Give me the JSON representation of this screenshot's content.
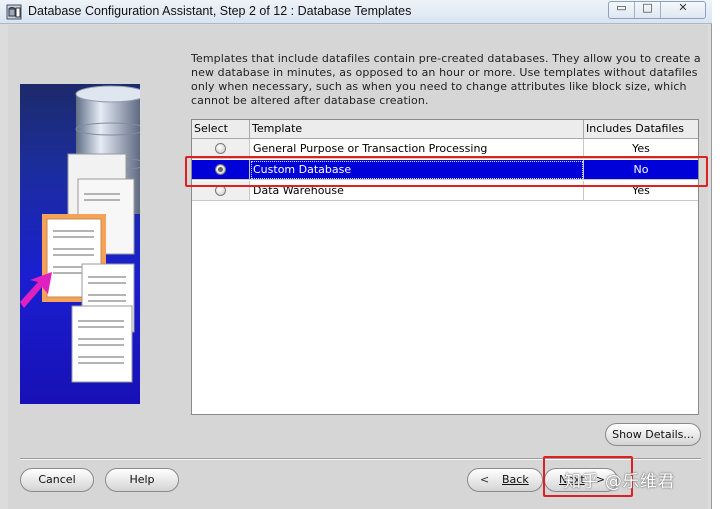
{
  "window": {
    "title": "Database Configuration Assistant, Step 2 of 12 : Database Templates",
    "controls": [
      "minimize",
      "maximize",
      "close"
    ]
  },
  "description": "Templates that include datafiles contain pre-created databases. They allow you to create a new database in minutes, as opposed to an hour or more. Use templates without datafiles only when necessary, such as when you need to change attributes like block size, which cannot be altered after database creation.",
  "table": {
    "columns": {
      "select": "Select",
      "template": "Template",
      "includes": "Includes Datafiles"
    },
    "rows": [
      {
        "template": "General Purpose or Transaction Processing",
        "includes": "Yes",
        "selected": false
      },
      {
        "template": "Custom Database",
        "includes": "No",
        "selected": true
      },
      {
        "template": "Data Warehouse",
        "includes": "Yes",
        "selected": false
      }
    ]
  },
  "buttons": {
    "show_details": "Show Details...",
    "cancel": "Cancel",
    "help": "Help",
    "back": "Back",
    "next": "Next"
  },
  "watermark": "知乎 @乐维君",
  "colors": {
    "selection": "#0000d8",
    "highlight_box": "#e02020"
  }
}
